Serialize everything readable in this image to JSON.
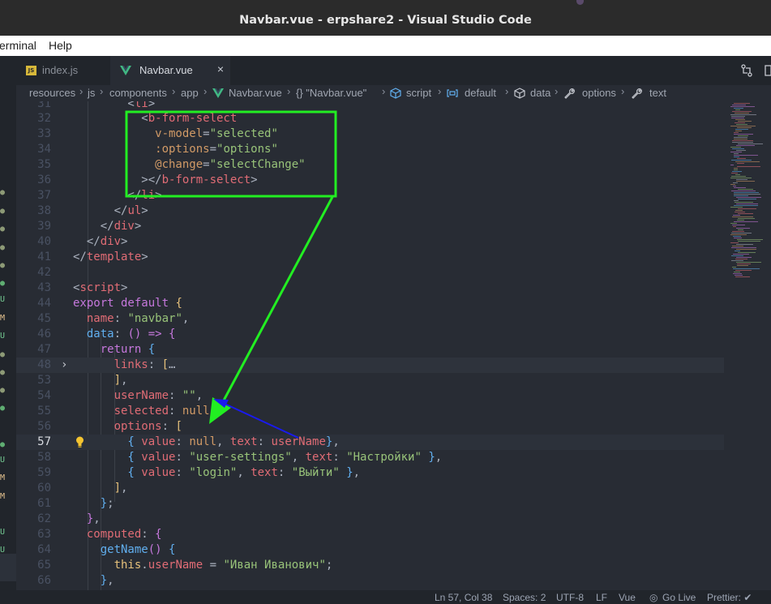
{
  "window": {
    "title": "Navbar.vue - erpshare2 - Visual Studio Code"
  },
  "menu": {
    "items": [
      "erminal",
      "Help"
    ]
  },
  "tabs": [
    {
      "label": "index.js",
      "icon": "js-file-icon"
    },
    {
      "label": "Navbar.vue",
      "icon": "vue-file-icon",
      "close": "×"
    }
  ],
  "breadcrumb": [
    "resources",
    "js",
    "components",
    "app",
    "Navbar.vue",
    "{} \"Navbar.vue\"",
    "script",
    "default",
    "data",
    "options",
    "text"
  ],
  "editor": {
    "current_line": 57,
    "lines": [
      {
        "n": "31",
        "code": "        <li>"
      },
      {
        "n": "32",
        "code": "          <b-form-select"
      },
      {
        "n": "33",
        "code": "            v-model=\"selected\""
      },
      {
        "n": "34",
        "code": "            :options=\"options\""
      },
      {
        "n": "35",
        "code": "            @change=\"selectChange\""
      },
      {
        "n": "36",
        "code": "          ></b-form-select>"
      },
      {
        "n": "37",
        "code": "        </li>"
      },
      {
        "n": "38",
        "code": "      </ul>"
      },
      {
        "n": "39",
        "code": "    </div>"
      },
      {
        "n": "40",
        "code": "  </div>"
      },
      {
        "n": "41",
        "code": "</template>"
      },
      {
        "n": "42",
        "code": ""
      },
      {
        "n": "43",
        "code": "<script>"
      },
      {
        "n": "44",
        "code": "export default {"
      },
      {
        "n": "45",
        "code": "  name: \"navbar\","
      },
      {
        "n": "46",
        "code": "  data: () => {"
      },
      {
        "n": "47",
        "code": "    return {"
      },
      {
        "n": "48",
        "code": "      links: […"
      },
      {
        "n": "53",
        "code": "      ],"
      },
      {
        "n": "54",
        "code": "      userName: \"\","
      },
      {
        "n": "55",
        "code": "      selected: null,"
      },
      {
        "n": "56",
        "code": "      options: ["
      },
      {
        "n": "57",
        "code": "        { value: null, text: userName},"
      },
      {
        "n": "58",
        "code": "        { value: \"user-settings\", text: \"Настройки\" },"
      },
      {
        "n": "59",
        "code": "        { value: \"login\", text: \"Выйти\" },"
      },
      {
        "n": "60",
        "code": "      ],"
      },
      {
        "n": "61",
        "code": "    };"
      },
      {
        "n": "62",
        "code": "  },"
      },
      {
        "n": "63",
        "code": "  computed: {"
      },
      {
        "n": "64",
        "code": "    getName() {"
      },
      {
        "n": "65",
        "code": "      this.userName = \"Иван Иванович\";"
      },
      {
        "n": "66",
        "code": "    },"
      }
    ]
  },
  "gutter_markers": [
    "U",
    "M",
    "U",
    "U",
    "M",
    "M",
    "U",
    "U"
  ],
  "status": {
    "position": "Ln 57, Col 38",
    "spaces": "Spaces: 2",
    "encoding": "UTF-8",
    "eol": "LF",
    "language": "Vue",
    "golive": "Go Live",
    "prettier": "Prettier: ✔"
  },
  "colors": {
    "editor_bg": "#282c34",
    "tag": "#e06c75",
    "attribute": "#d19a66",
    "string": "#98c379",
    "keyword": "#c678dd",
    "function": "#61afef",
    "annotation_green": "#22ee22",
    "annotation_blue": "#1a1aee"
  }
}
